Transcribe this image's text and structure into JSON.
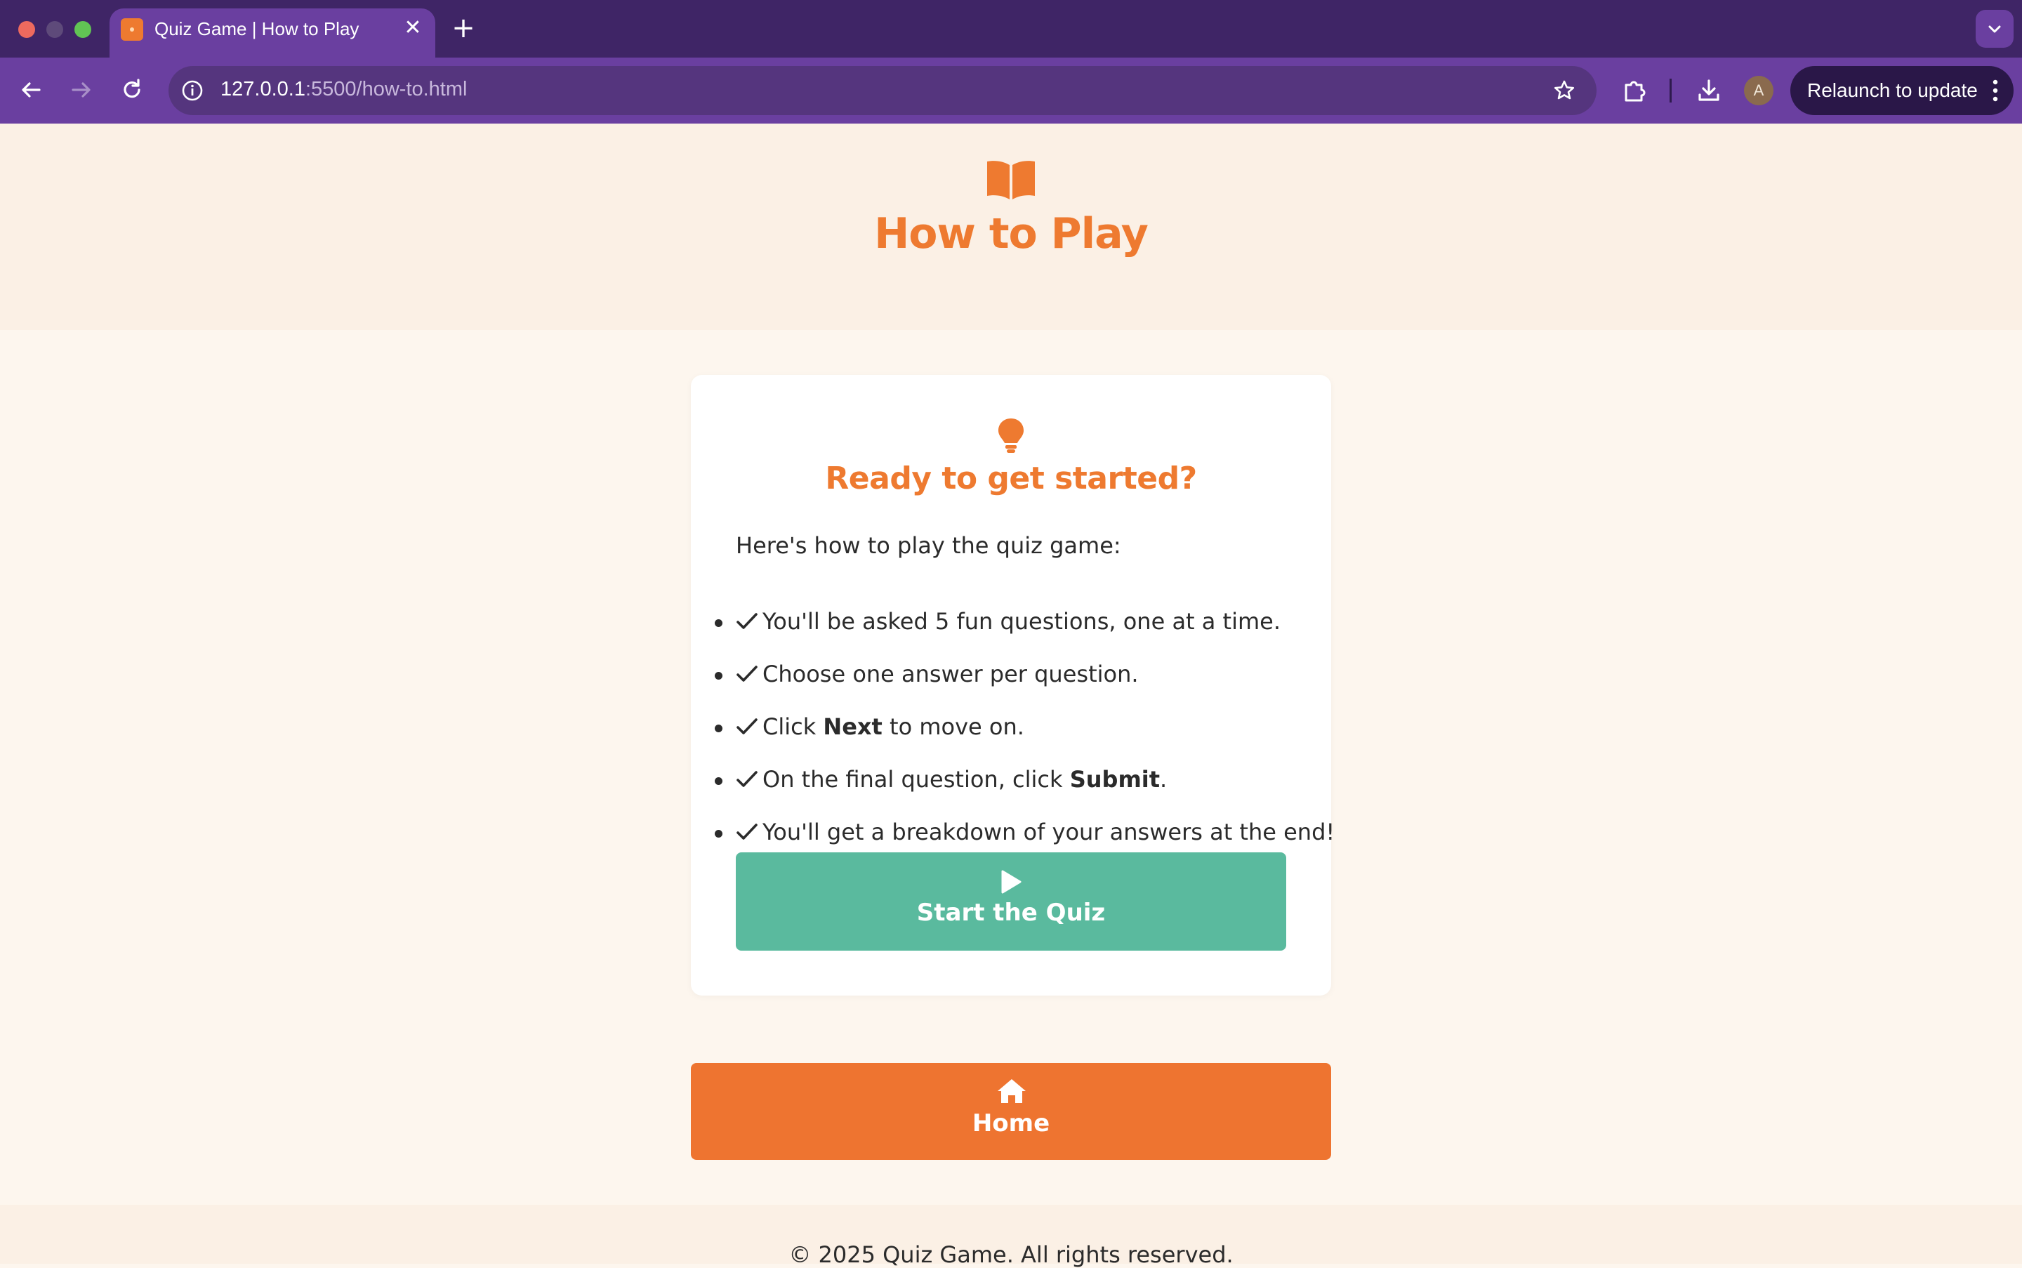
{
  "browser": {
    "tab_title": "Quiz Game | How to Play",
    "url_host": "127.0.0.1",
    "url_path": ":5500/how-to.html",
    "profile_initial": "A",
    "relaunch_label": "Relaunch to update",
    "accent_color": "#6a3fa0"
  },
  "header": {
    "icon": "book-open-icon",
    "title": "How to Play"
  },
  "card": {
    "icon": "lightbulb-icon",
    "title": "Ready to get started?",
    "intro": "Here's how to play the quiz game:",
    "steps": [
      {
        "pre": "You'll be asked 5 fun questions, one at a time.",
        "bold": "",
        "post": ""
      },
      {
        "pre": "Choose one answer per question.",
        "bold": "",
        "post": ""
      },
      {
        "pre": "Click ",
        "bold": "Next",
        "post": " to move on."
      },
      {
        "pre": "On the final question, click ",
        "bold": "Submit",
        "post": "."
      },
      {
        "pre": "You'll get a breakdown of your answers at the end!",
        "bold": "",
        "post": ""
      }
    ],
    "start_button": {
      "icon": "play-icon",
      "label": "Start the Quiz",
      "color": "#5aba9e"
    }
  },
  "home_button": {
    "icon": "home-icon",
    "label": "Home",
    "color": "#ee7430"
  },
  "footer": {
    "text": "© 2025 Quiz Game. All rights reserved."
  },
  "theme": {
    "primary": "#ee7a30",
    "header_bg": "#fbf0e5",
    "page_bg": "#fdf6ee"
  }
}
